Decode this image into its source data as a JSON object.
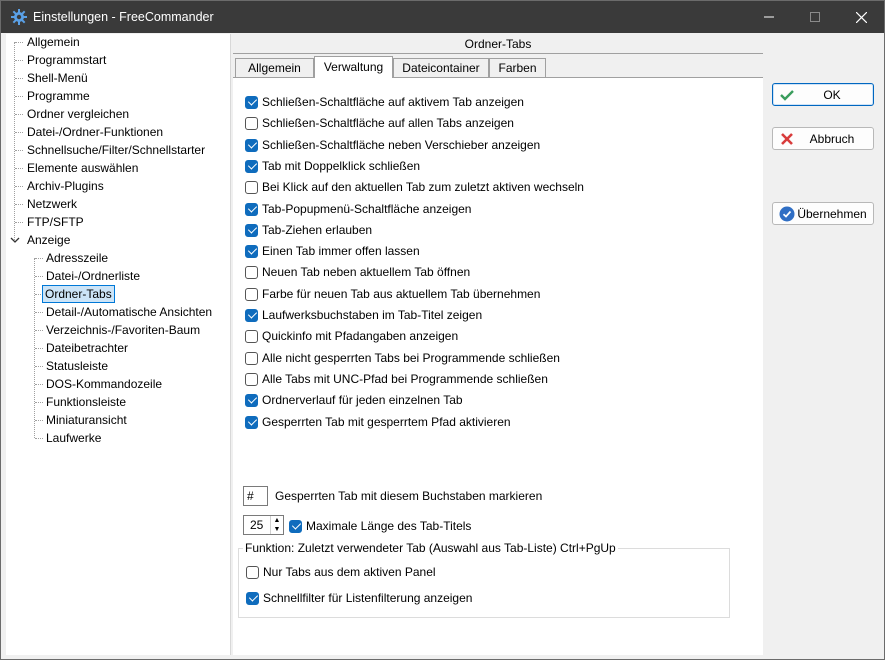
{
  "window": {
    "title": "Einstellungen - FreeCommander"
  },
  "tree": {
    "items": [
      {
        "label": "Allgemein"
      },
      {
        "label": "Programmstart"
      },
      {
        "label": "Shell-Menü"
      },
      {
        "label": "Programme"
      },
      {
        "label": "Ordner vergleichen"
      },
      {
        "label": "Datei-/Ordner-Funktionen"
      },
      {
        "label": "Schnellsuche/Filter/Schnellstarter"
      },
      {
        "label": "Elemente auswählen"
      },
      {
        "label": "Archiv-Plugins"
      },
      {
        "label": "Netzwerk"
      },
      {
        "label": "FTP/SFTP"
      },
      {
        "label": "Anzeige"
      }
    ],
    "children": [
      {
        "label": "Adresszeile"
      },
      {
        "label": "Datei-/Ordnerliste"
      },
      {
        "label": "Ordner-Tabs",
        "selected": true
      },
      {
        "label": "Detail-/Automatische Ansichten"
      },
      {
        "label": "Verzeichnis-/Favoriten-Baum"
      },
      {
        "label": "Dateibetrachter"
      },
      {
        "label": "Statusleiste"
      },
      {
        "label": "DOS-Kommandozeile"
      },
      {
        "label": "Funktionsleiste"
      },
      {
        "label": "Miniaturansicht"
      },
      {
        "label": "Laufwerke"
      }
    ]
  },
  "content": {
    "header": "Ordner-Tabs",
    "tabs": [
      {
        "label": "Allgemein"
      },
      {
        "label": "Verwaltung",
        "active": true
      },
      {
        "label": "Dateicontainer"
      },
      {
        "label": "Farben"
      }
    ],
    "options": [
      {
        "label": "Schließen-Schaltfläche auf aktivem Tab anzeigen",
        "checked": true
      },
      {
        "label": "Schließen-Schaltfläche auf allen Tabs anzeigen",
        "checked": false
      },
      {
        "label": "Schließen-Schaltfläche neben Verschieber anzeigen",
        "checked": true
      },
      {
        "label": "Tab mit Doppelklick schließen",
        "checked": true
      },
      {
        "label": "Bei Klick auf den aktuellen Tab zum zuletzt aktiven wechseln",
        "checked": false
      },
      {
        "label": "Tab-Popupmenü-Schaltfläche anzeigen",
        "checked": true
      },
      {
        "label": "Tab-Ziehen erlauben",
        "checked": true
      },
      {
        "label": "Einen Tab immer offen lassen",
        "checked": true
      },
      {
        "label": "Neuen Tab neben aktuellem Tab öffnen",
        "checked": false
      },
      {
        "label": "Farbe für neuen Tab aus aktuellem Tab übernehmen",
        "checked": false
      },
      {
        "label": "Laufwerksbuchstaben im Tab-Titel zeigen",
        "checked": true
      },
      {
        "label": "Quickinfo mit Pfadangaben anzeigen",
        "checked": false
      },
      {
        "label": "Alle nicht gesperrten Tabs bei Programmende schließen",
        "checked": false
      },
      {
        "label": "Alle Tabs mit UNC-Pfad bei Programmende schließen",
        "checked": false
      },
      {
        "label": "Ordnerverlauf für jeden einzelnen Tab",
        "checked": true
      },
      {
        "label": "Gesperrten Tab mit gesperrtem Pfad aktivieren",
        "checked": true
      }
    ],
    "lock_char": {
      "value": "#",
      "label": "Gesperrten Tab mit diesem Buchstaben markieren"
    },
    "max_length": {
      "value": "25",
      "label": "Maximale Länge des Tab-Titels",
      "checked": true
    },
    "group": {
      "title": "Funktion: Zuletzt verwendeter Tab (Auswahl aus Tab-Liste) Ctrl+PgUp",
      "options": [
        {
          "label": "Nur Tabs aus dem aktiven Panel",
          "checked": false
        },
        {
          "label": "Schnellfilter für Listenfilterung anzeigen",
          "checked": true
        }
      ]
    }
  },
  "buttons": {
    "ok": "OK",
    "cancel": "Abbruch",
    "apply": "Übernehmen"
  },
  "colors": {
    "accent": "#0f6cbd",
    "titlebar": "#3a3a3a",
    "selection": "#cce4f7"
  }
}
